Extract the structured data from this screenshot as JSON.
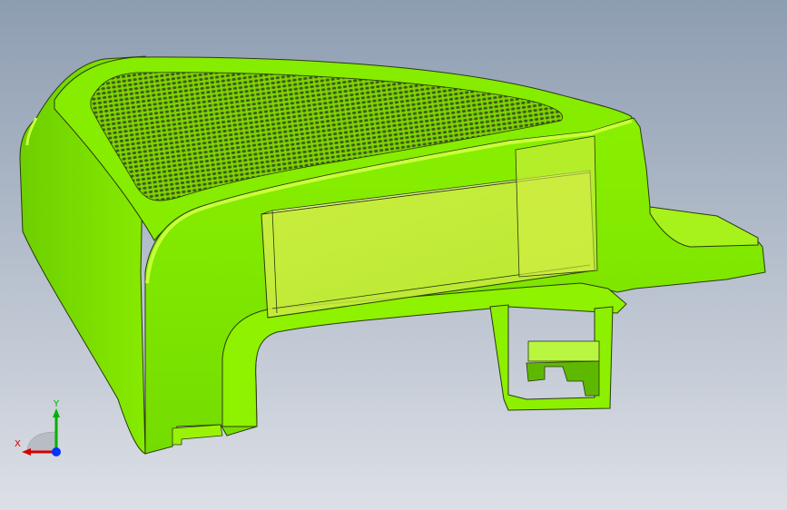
{
  "colors": {
    "background_top": "#8d9db1",
    "background_bottom": "#dcdfe6",
    "part_body": "#7fe600",
    "part_highlight": "#aef81e",
    "part_shadow": "#5fb800",
    "part_edge": "#2a3a10",
    "transparent_box": "#d7ef4a",
    "mesh": "#3f5a18",
    "axis_x": "#d40000",
    "axis_y": "#00b000",
    "axis_z": "#0033ff"
  },
  "triad": {
    "x_label": "X",
    "y_label": "Y"
  },
  "icons": {
    "triad": "coordinate-triad-icon"
  }
}
